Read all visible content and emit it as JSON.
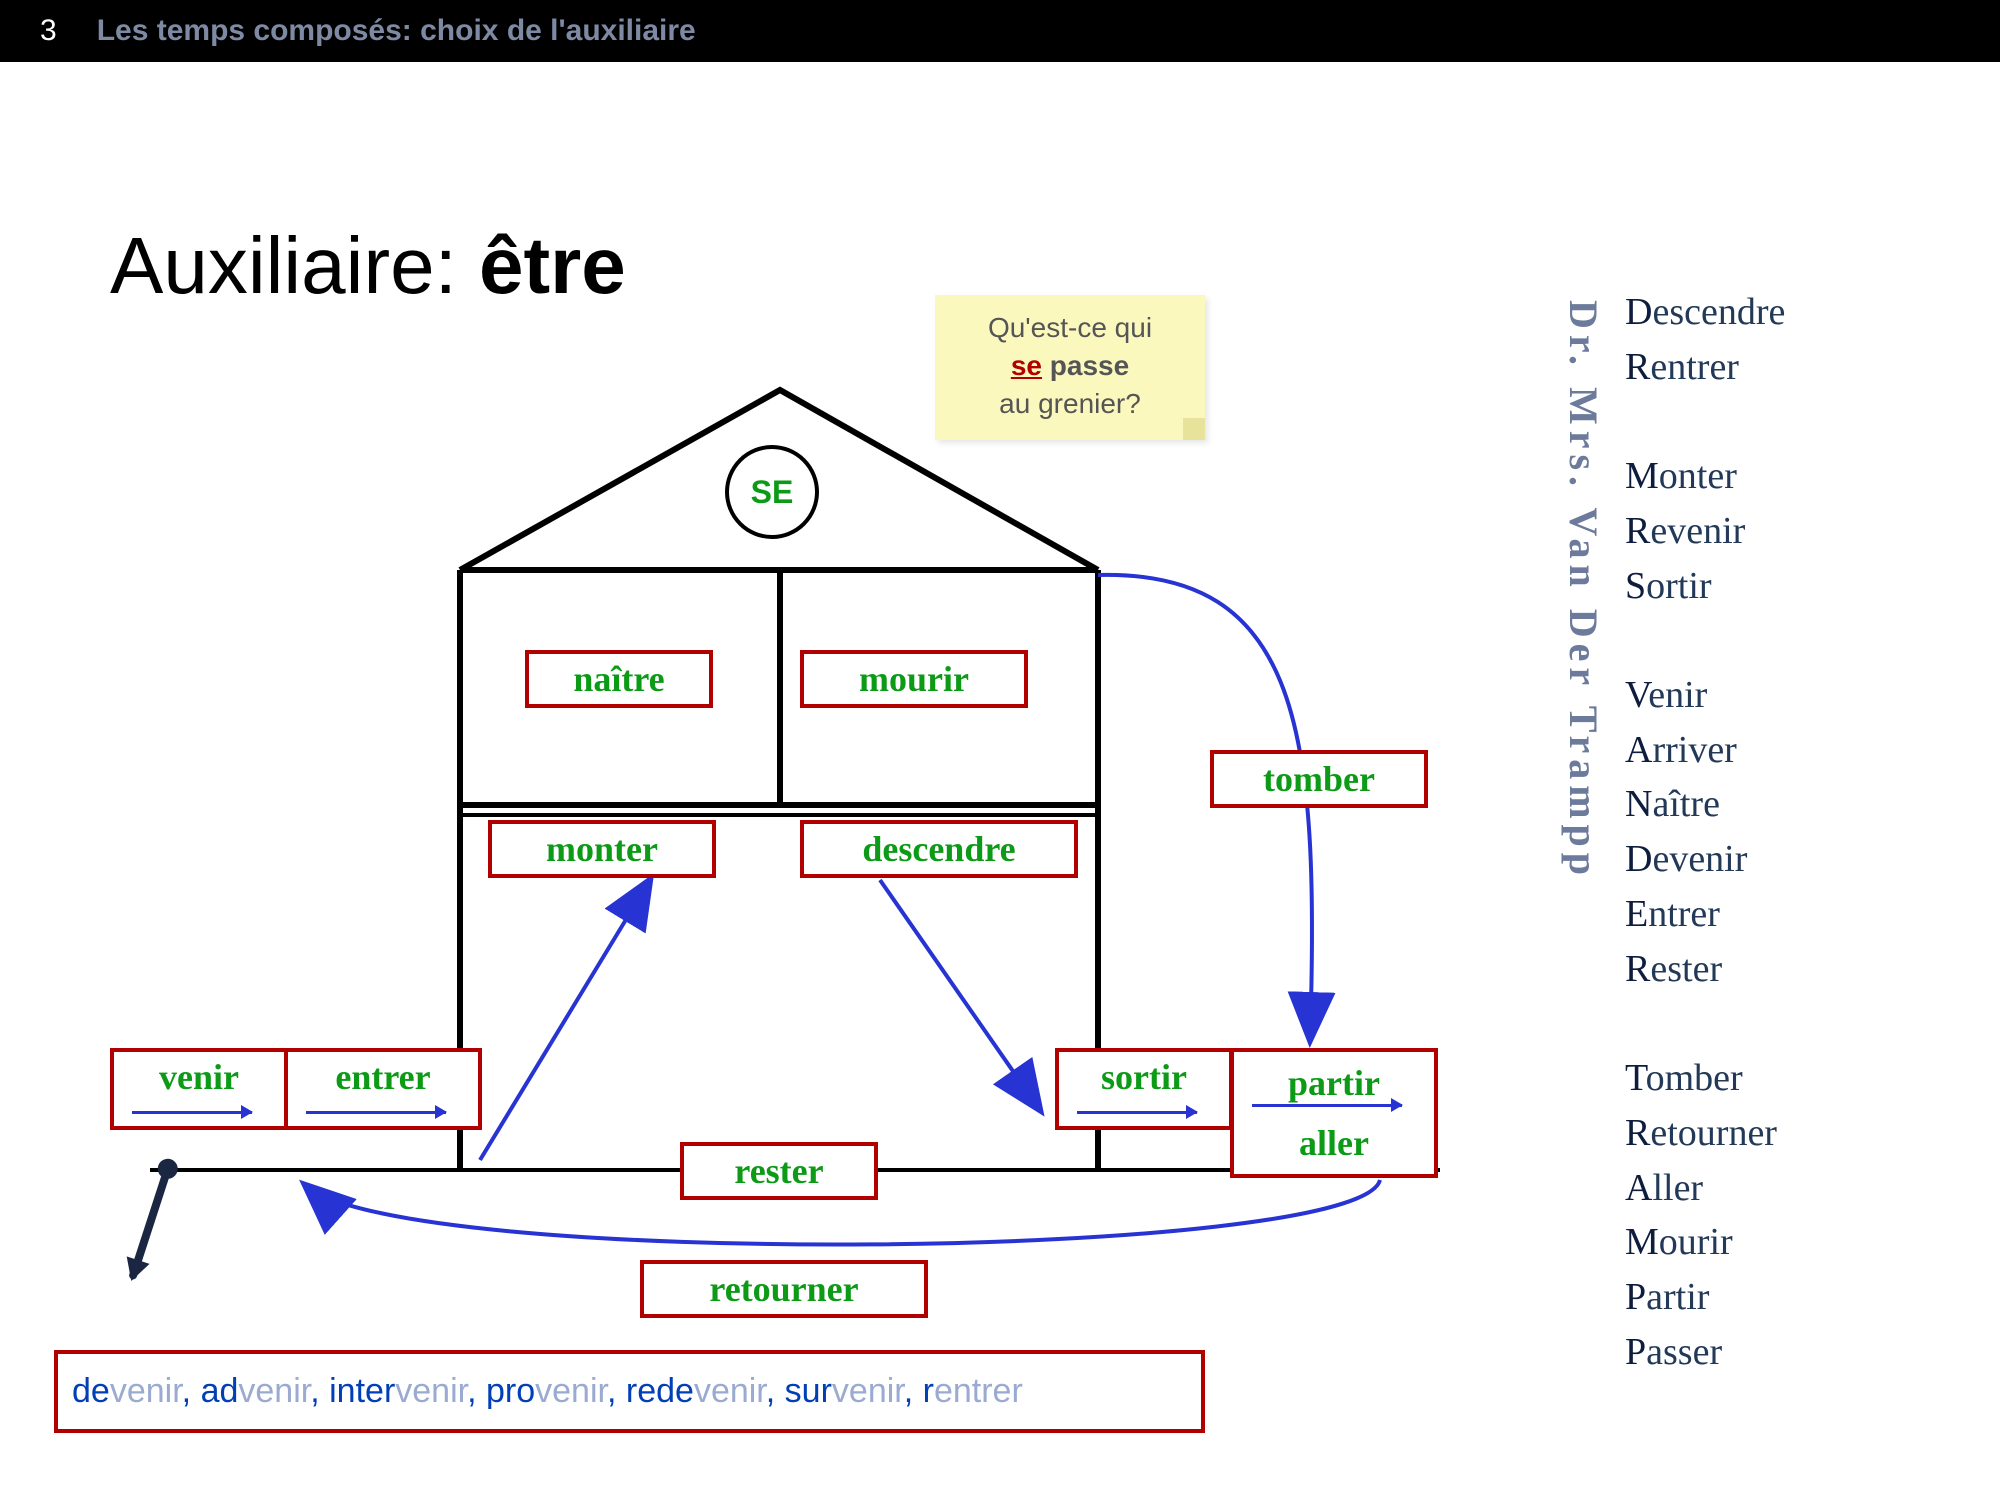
{
  "header": {
    "num": "3",
    "title": "Les temps composés: choix de l'auxiliaire"
  },
  "title_pre": "Auxiliaire: ",
  "title_bold": "être",
  "sticky": {
    "l1": "Qu'est-ce qui",
    "se": "se",
    "l2a": " passe",
    "l3": "au grenier?"
  },
  "se_label": "SE",
  "verbs": {
    "naitre": "naître",
    "mourir": "mourir",
    "monter": "monter",
    "descendre": "descendre",
    "venir": "venir",
    "entrer": "entrer",
    "sortir": "sortir",
    "partir": "partir",
    "aller": "aller",
    "tomber": "tomber",
    "rester": "rester",
    "retourner": "retourner"
  },
  "vertical": "Dr. Mrs. Van Der Trampp",
  "mnemonic": [
    "Descendre",
    "Rentrer",
    "",
    "Monter",
    "Revenir",
    "Sortir",
    "",
    "Venir",
    "Arriver",
    "Naître",
    "Devenir",
    "Entrer",
    "Rester",
    "",
    "Tomber",
    "Retourner",
    "Aller",
    "Mourir",
    "Partir",
    "Passer"
  ],
  "derived": [
    {
      "pre": "de",
      "root": "venir"
    },
    {
      "pre": "ad",
      "root": "venir"
    },
    {
      "pre": "inter",
      "root": "venir"
    },
    {
      "pre": "pro",
      "root": "venir"
    },
    {
      "pre": "rede",
      "root": "venir"
    },
    {
      "pre": "sur",
      "root": "venir"
    },
    {
      "pre": "r",
      "root": "entrer"
    }
  ]
}
